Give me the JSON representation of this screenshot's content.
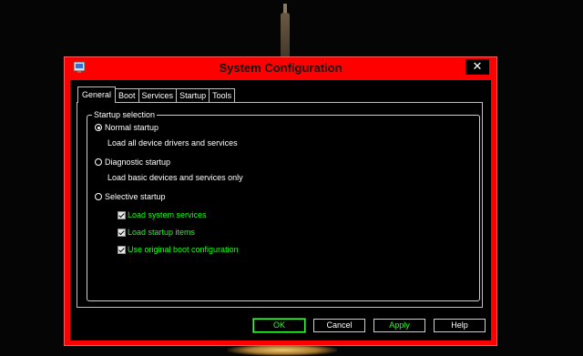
{
  "window": {
    "title": "System Configuration",
    "close_label": "✕",
    "accent_color": "#ff0000"
  },
  "tabs": [
    {
      "label": "General",
      "active": true
    },
    {
      "label": "Boot",
      "active": false
    },
    {
      "label": "Services",
      "active": false
    },
    {
      "label": "Startup",
      "active": false
    },
    {
      "label": "Tools",
      "active": false
    }
  ],
  "startup_selection": {
    "legend": "Startup selection",
    "normal": {
      "label": "Normal startup",
      "description": "Load all device drivers and services",
      "checked": true
    },
    "diagnostic": {
      "label": "Diagnostic startup",
      "description": "Load basic devices and services only",
      "checked": false
    },
    "selective": {
      "label": "Selective startup",
      "checked": false
    },
    "options": [
      {
        "label": "Load system services",
        "checked": true
      },
      {
        "label": "Load startup items",
        "checked": true
      },
      {
        "label": "Use original boot configuration",
        "checked": true
      }
    ]
  },
  "buttons": {
    "ok": "OK",
    "cancel": "Cancel",
    "apply": "Apply",
    "help": "Help"
  }
}
